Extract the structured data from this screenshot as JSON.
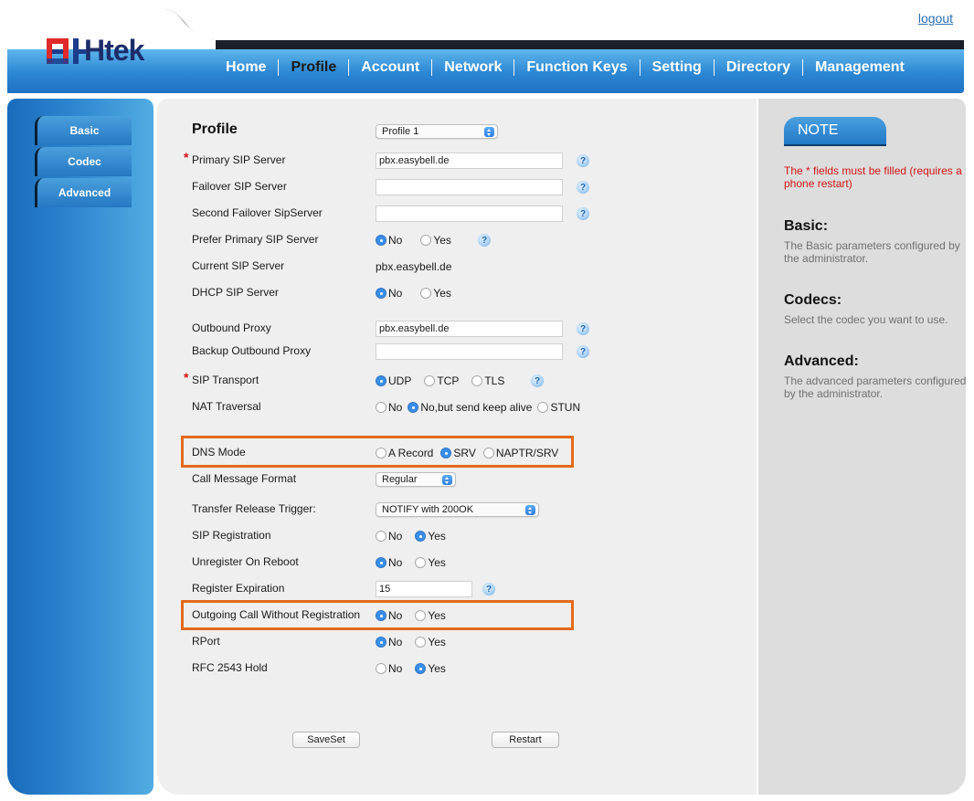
{
  "header": {
    "logo_text": "Htek",
    "logout": "logout",
    "nav": [
      {
        "label": "Home",
        "active": false
      },
      {
        "label": "Profile",
        "active": true
      },
      {
        "label": "Account",
        "active": false
      },
      {
        "label": "Network",
        "active": false
      },
      {
        "label": "Function Keys",
        "active": false
      },
      {
        "label": "Setting",
        "active": false
      },
      {
        "label": "Directory",
        "active": false
      },
      {
        "label": "Management",
        "active": false
      }
    ]
  },
  "sidebar": {
    "items": [
      {
        "label": "Basic",
        "active": true
      },
      {
        "label": "Codec",
        "active": false
      },
      {
        "label": "Advanced",
        "active": false
      }
    ]
  },
  "form": {
    "title": "Profile",
    "profile_select": "Profile 1",
    "primary_sip_server": {
      "label": "Primary SIP Server",
      "value": "pbx.easybell.de"
    },
    "failover_sip_server": {
      "label": "Failover SIP Server",
      "value": ""
    },
    "second_failover": {
      "label": "Second Failover SipServer",
      "value": ""
    },
    "prefer_primary": {
      "label": "Prefer Primary SIP Server",
      "options": [
        "No",
        "Yes"
      ],
      "selected": "No"
    },
    "current_sip_server": {
      "label": "Current SIP Server",
      "value": "pbx.easybell.de"
    },
    "dhcp_sip_server": {
      "label": "DHCP SIP Server",
      "options": [
        "No",
        "Yes"
      ],
      "selected": "No"
    },
    "outbound_proxy": {
      "label": "Outbound Proxy",
      "value": "pbx.easybell.de"
    },
    "backup_outbound_proxy": {
      "label": "Backup Outbound Proxy",
      "value": ""
    },
    "sip_transport": {
      "label": "SIP Transport",
      "options": [
        "UDP",
        "TCP",
        "TLS"
      ],
      "selected": "UDP"
    },
    "nat_traversal": {
      "label": "NAT Traversal",
      "options": [
        "No",
        "No,but send keep alive",
        "STUN"
      ],
      "selected": "No,but send keep alive"
    },
    "dns_mode": {
      "label": "DNS Mode",
      "options": [
        "A Record",
        "SRV",
        "NAPTR/SRV"
      ],
      "selected": "SRV"
    },
    "call_message_format": {
      "label": "Call Message Format",
      "value": "Regular"
    },
    "transfer_release_trigger": {
      "label": "Transfer Release Trigger:",
      "value": "NOTIFY with 200OK"
    },
    "sip_registration": {
      "label": "SIP Registration",
      "options": [
        "No",
        "Yes"
      ],
      "selected": "Yes"
    },
    "unregister_on_reboot": {
      "label": "Unregister On Reboot",
      "options": [
        "No",
        "Yes"
      ],
      "selected": "No"
    },
    "register_expiration": {
      "label": "Register Expiration",
      "value": "15"
    },
    "outgoing_call_without_registration": {
      "label": "Outgoing Call Without Registration",
      "options": [
        "No",
        "Yes"
      ],
      "selected": "No"
    },
    "rport": {
      "label": "RPort",
      "options": [
        "No",
        "Yes"
      ],
      "selected": "No"
    },
    "rfc2543_hold": {
      "label": "RFC 2543 Hold",
      "options": [
        "No",
        "Yes"
      ],
      "selected": "Yes"
    },
    "required_star": "*",
    "help_glyph": "?",
    "buttons": {
      "saveset": "SaveSet",
      "restart": "Restart"
    }
  },
  "note": {
    "tab": "NOTE",
    "warning": "The * fields must be filled (requires a phone restart)",
    "sections": [
      {
        "heading": "Basic:",
        "text": "The Basic parameters configured by the administrator."
      },
      {
        "heading": "Codecs:",
        "text": "Select the codec you want to use."
      },
      {
        "heading": "Advanced:",
        "text": "The advanced parameters configured by the administrator."
      }
    ]
  },
  "colors": {
    "brand_blue": "#2d86cf",
    "logo_red": "#e02a2a",
    "highlight_orange": "#e36a1c",
    "required_red": "#d01010"
  },
  "icons": [
    "help-icon",
    "select-arrow-icon",
    "radio-icon"
  ]
}
